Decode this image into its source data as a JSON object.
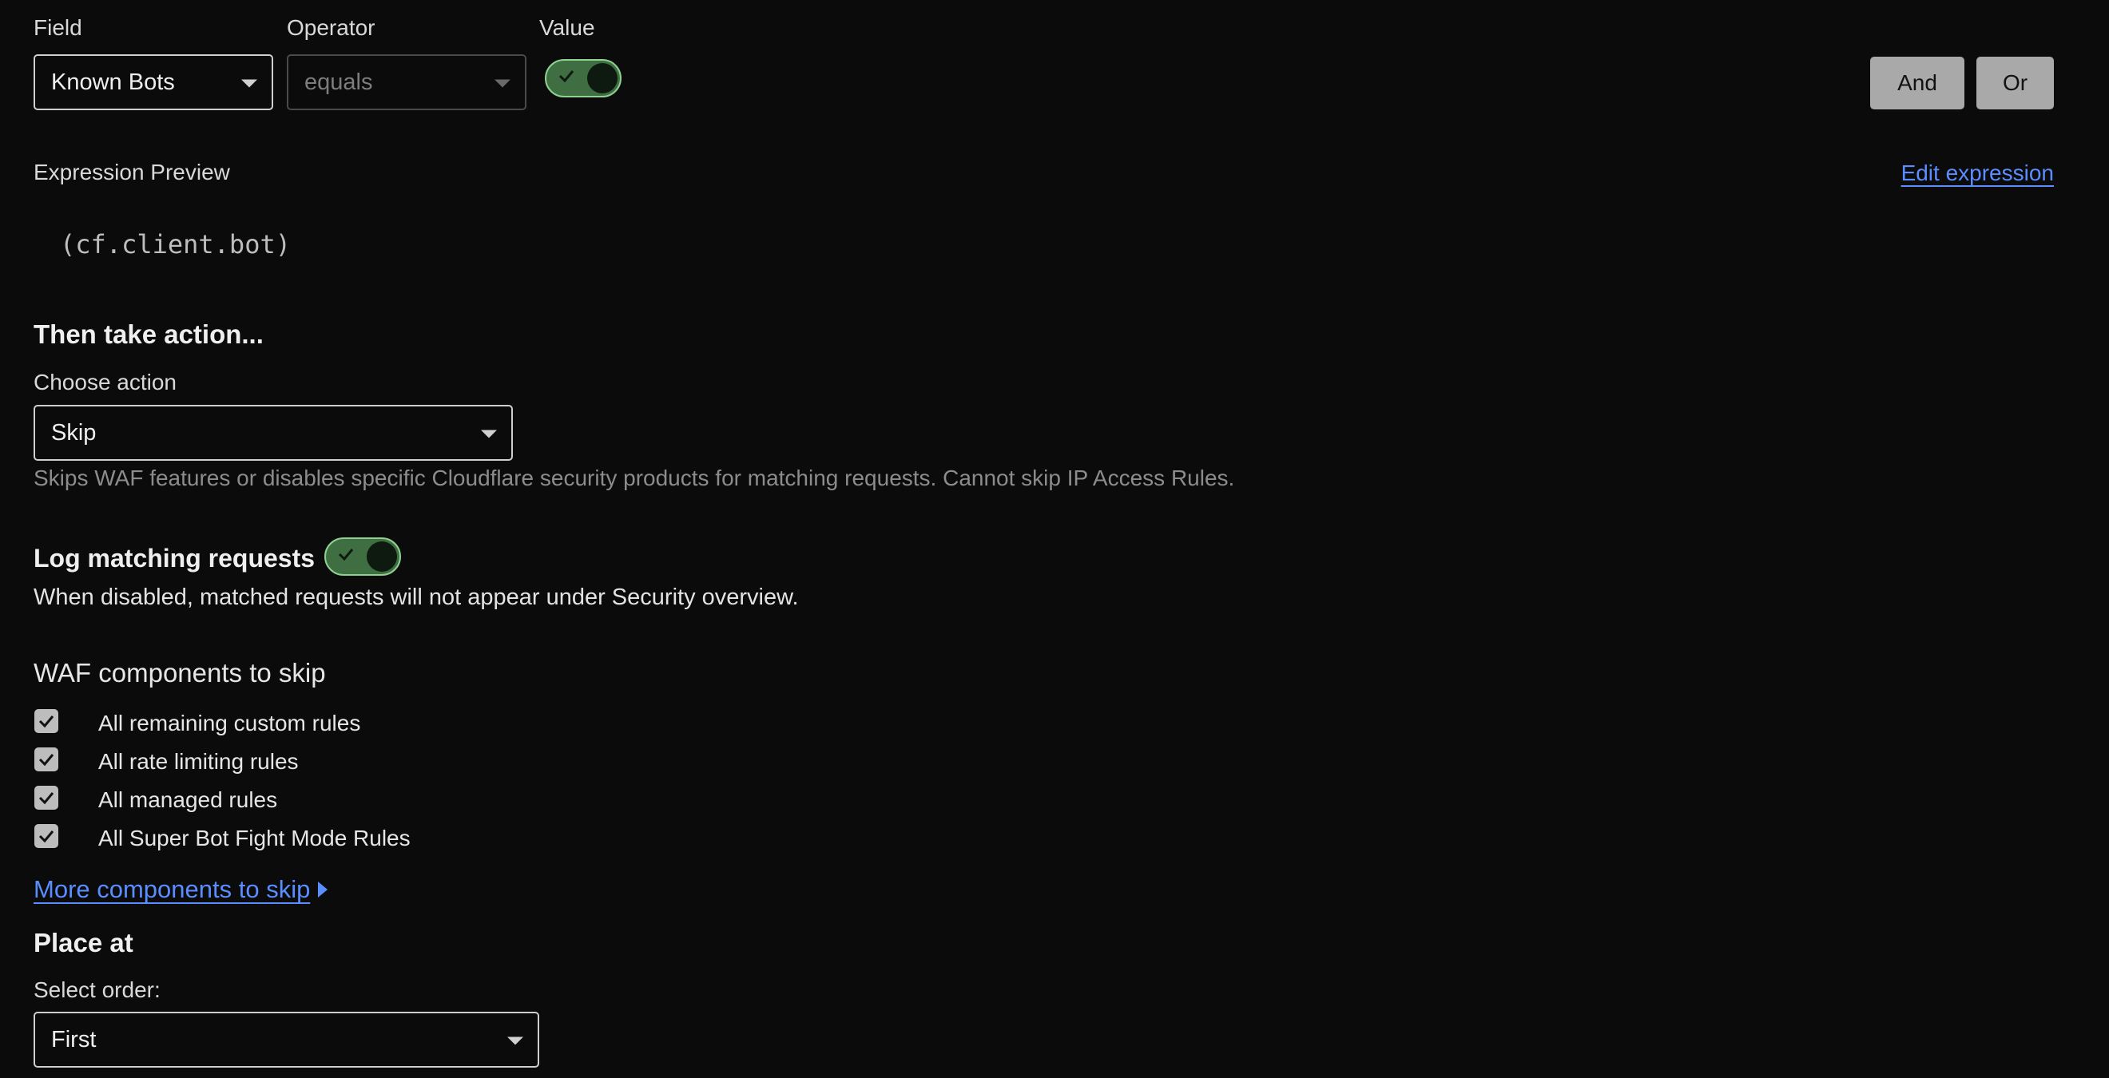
{
  "expression_builder": {
    "field_label": "Field",
    "operator_label": "Operator",
    "value_label": "Value",
    "field_value": "Known Bots",
    "operator_value": "equals",
    "value_toggle_on": true,
    "and_label": "And",
    "or_label": "Or"
  },
  "preview": {
    "label": "Expression Preview",
    "edit_link": "Edit expression",
    "expression": "(cf.client.bot)"
  },
  "action": {
    "heading": "Then take action...",
    "choose_label": "Choose action",
    "selected": "Skip",
    "description": "Skips WAF features or disables specific Cloudflare security products for matching requests. Cannot skip IP Access Rules."
  },
  "logging": {
    "label": "Log matching requests",
    "toggle_on": true,
    "description": "When disabled, matched requests will not appear under Security overview."
  },
  "skip": {
    "heading": "WAF components to skip",
    "components": [
      {
        "label": "All remaining custom rules",
        "checked": true
      },
      {
        "label": "All rate limiting rules",
        "checked": true
      },
      {
        "label": "All managed rules",
        "checked": true
      },
      {
        "label": "All Super Bot Fight Mode Rules",
        "checked": true
      }
    ],
    "more_link": "More components to skip"
  },
  "place": {
    "heading": "Place at",
    "order_label": "Select order:",
    "order_value": "First"
  },
  "colors": {
    "background": "#0b0b0c",
    "link": "#5a8dff",
    "toggle_on": "#3f6e42",
    "toggle_border": "#8fd190"
  }
}
